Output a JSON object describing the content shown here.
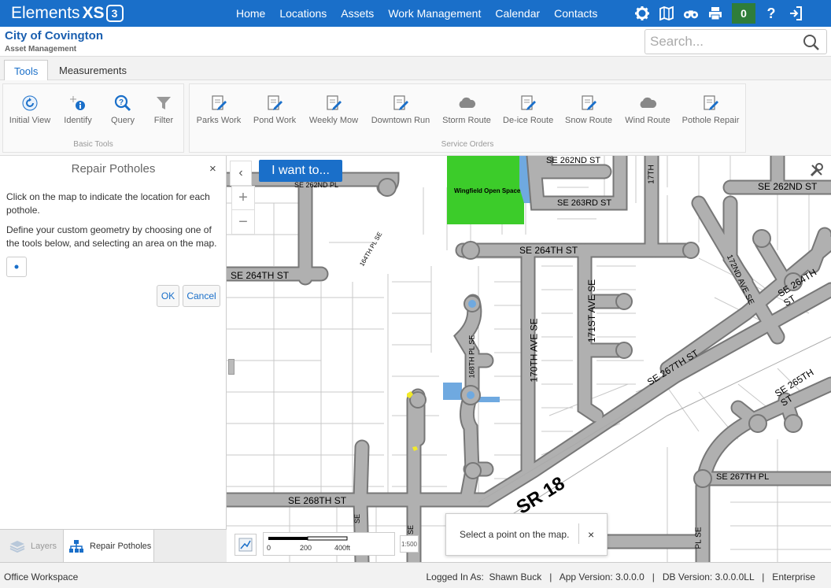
{
  "app": {
    "logo_text": "Elements",
    "logo_x": "XS",
    "logo_3": "3"
  },
  "nav": [
    "Home",
    "Locations",
    "Assets",
    "Work Management",
    "Calendar",
    "Contacts"
  ],
  "top_icons": [
    "gear-icon",
    "map-icon",
    "binoculars-icon",
    "printer-icon",
    "notification-count",
    "help-icon",
    "logout-icon"
  ],
  "notification_count": "0",
  "help_label": "?",
  "title": {
    "city": "City of Covington",
    "subtitle": "Asset Management"
  },
  "search": {
    "placeholder": "Search..."
  },
  "tabs": [
    "Tools",
    "Measurements"
  ],
  "ribbon": {
    "basic_tools": {
      "title": "Basic Tools",
      "items": [
        "Initial View",
        "Identify",
        "Query",
        "Filter"
      ]
    },
    "service_orders": {
      "title": "Service Orders",
      "items": [
        "Parks Work",
        "Pond Work",
        "Weekly Mow",
        "Downtown Run",
        "Storm Route",
        "De-ice Route",
        "Snow Route",
        "Wind Route",
        "Pothole Repair"
      ]
    }
  },
  "panel": {
    "title": "Repair Potholes",
    "close": "×",
    "text1": "Click on the map to indicate the location for each pothole.",
    "text2": "Define your custom geometry by choosing one of the tools below, and selecting an area on the map.",
    "ok": "OK",
    "cancel": "Cancel"
  },
  "bottom_tabs": [
    "Layers",
    "Repair Potholes"
  ],
  "map": {
    "i_want": "I want to...",
    "collapse": "‹",
    "zoom_in": "+",
    "zoom_out": "−",
    "scale_labels": [
      "0",
      "200",
      "400ft"
    ],
    "scale_ratio": "1:500",
    "toast": {
      "text": "Select a point on the map.",
      "close": "×"
    },
    "labels": [
      "SE 262ND PL",
      "SE 262ND ST",
      "SE 263RD ST",
      "SE 262ND ST",
      "17TH",
      "Wingfield Open Space",
      "SE 264TH ST",
      "SE 264TH ST",
      "164TH PL SE",
      "SE 264TH ST",
      "172ND AVE SE",
      "168TH PL SE",
      "170TH AVE SE",
      "171ST AVE SE",
      "SE 267TH ST",
      "SE 265TH ST",
      "SE 267TH PL",
      "SR 18",
      "SE 268TH ST",
      "SE",
      "SE",
      "PL SE"
    ],
    "colors": {
      "road": "#b0b0b0",
      "road_edge": "#777777",
      "park": "#3ccc2a",
      "water": "#6fa9e0",
      "pothole": "#f2ea2a"
    }
  },
  "status": {
    "workspace": "Office Workspace",
    "right": "Logged In As:  Shawn Buck   |   App Version: 3.0.0.0   |   DB Version: 3.0.0.0LL   |   Enterprise"
  }
}
